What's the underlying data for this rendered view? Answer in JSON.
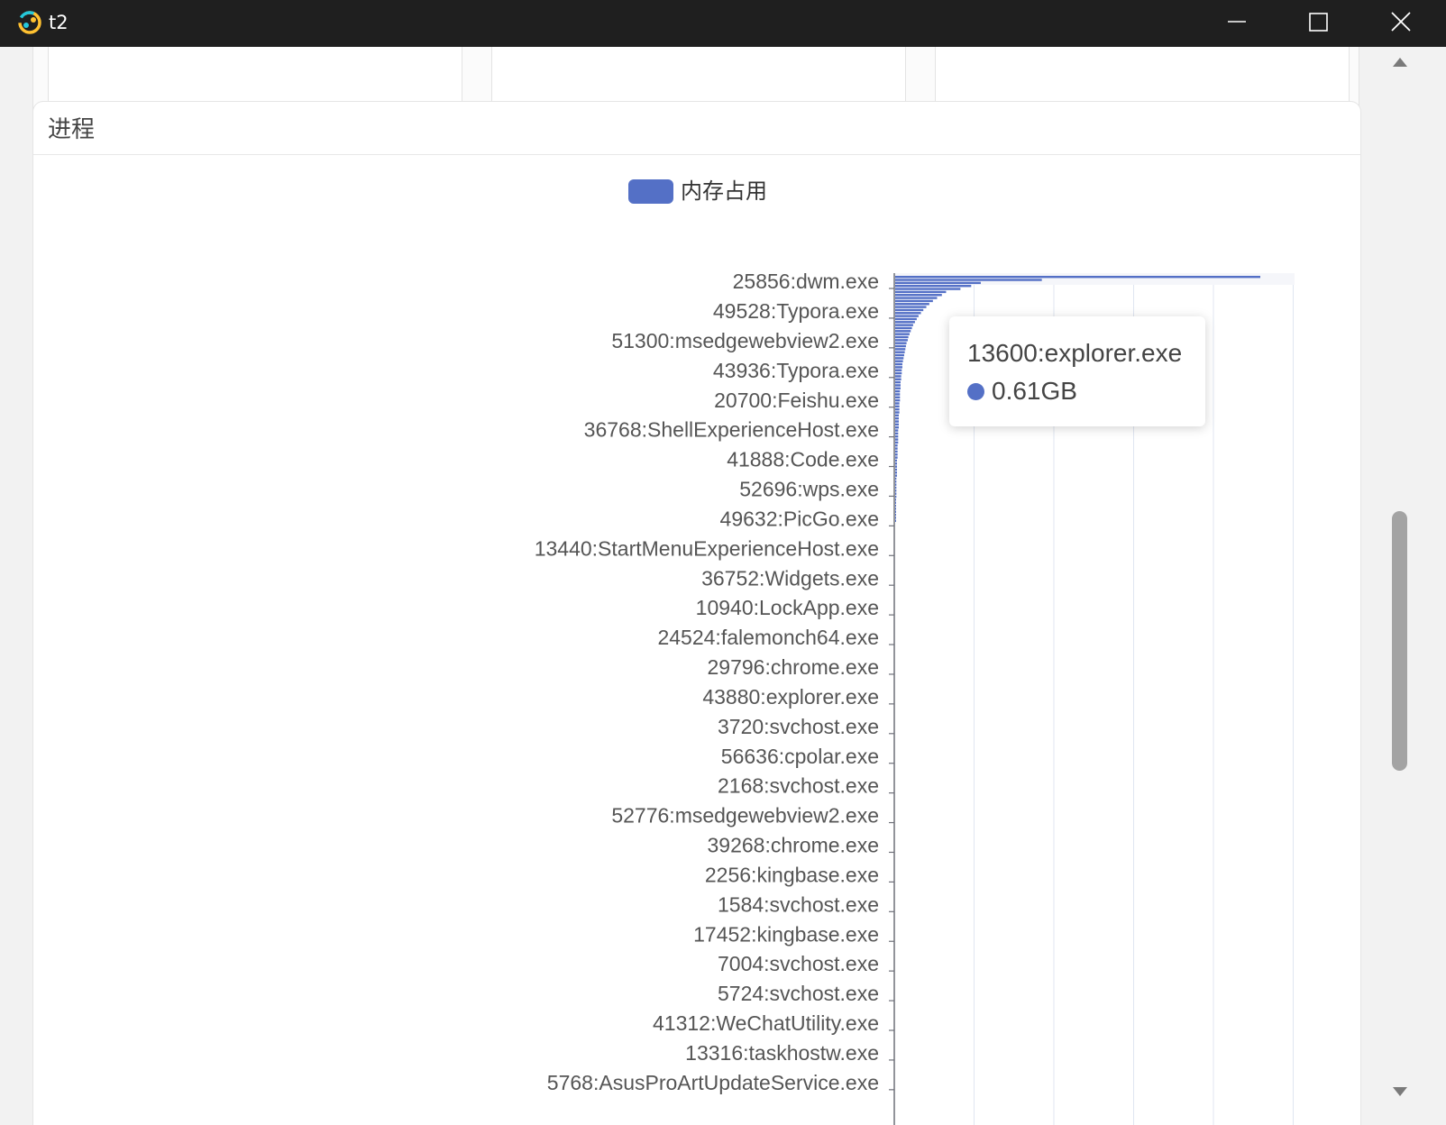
{
  "window": {
    "title": "t2",
    "controls": {
      "minimize": "minimize-icon",
      "maximize": "maximize-icon",
      "close": "close-icon"
    }
  },
  "panel": {
    "title": "进程"
  },
  "tooltip": {
    "name": "13600:explorer.exe",
    "value": "0.61GB"
  },
  "colors": {
    "series": "#5470c6",
    "titlebar": "#1f1f1f"
  },
  "chart_data": {
    "type": "bar",
    "orientation": "horizontal",
    "title": "",
    "legend": [
      "内存占用"
    ],
    "legend_position": "top-center",
    "series": [
      {
        "name": "内存占用",
        "values": [
          0.61,
          0.245,
          0.143,
          0.127,
          0.109,
          0.085,
          0.078,
          0.07,
          0.063,
          0.057,
          0.052,
          0.047,
          0.043,
          0.039,
          0.036,
          0.033,
          0.03,
          0.028,
          0.026,
          0.024,
          0.022,
          0.021,
          0.019,
          0.018,
          0.017,
          0.016,
          0.015,
          0.014,
          0.013,
          0.012,
          0.012,
          0.011,
          0.011,
          0.01,
          0.01,
          0.009,
          0.009,
          0.009,
          0.008,
          0.008,
          0.008,
          0.008,
          0.007,
          0.007,
          0.007,
          0.007,
          0.006,
          0.006,
          0.006,
          0.006,
          0.006,
          0.005,
          0.005,
          0.005,
          0.005,
          0.005,
          0.004,
          0.004,
          0.004,
          0.004,
          0.004,
          0.003,
          0.003,
          0.003,
          0.003,
          0.003,
          0.003,
          0.002,
          0.002,
          0.002,
          0.002,
          0.002,
          0.002,
          0.002,
          0.001,
          0.001,
          0.001,
          0.001,
          0.001,
          0.001,
          0.001,
          0.001
        ]
      }
    ],
    "tick_labels": [
      "25856:dwm.exe",
      "49528:Typora.exe",
      "51300:msedgewebview2.exe",
      "43936:Typora.exe",
      "20700:Feishu.exe",
      "36768:ShellExperienceHost.exe",
      "41888:Code.exe",
      "52696:wps.exe",
      "49632:PicGo.exe",
      "13440:StartMenuExperienceHost.exe",
      "36752:Widgets.exe",
      "10940:LockApp.exe",
      "24524:falemonch64.exe",
      "29796:chrome.exe",
      "43880:explorer.exe",
      "3720:svchost.exe",
      "56636:cpolar.exe",
      "2168:svchost.exe",
      "52776:msedgewebview2.exe",
      "39268:chrome.exe",
      "2256:kingbase.exe",
      "1584:svchost.exe",
      "17452:kingbase.exe",
      "7004:svchost.exe",
      "5724:svchost.exe",
      "41312:WeChatUtility.exe",
      "13316:taskhostw.exe",
      "5768:AsusProArtUpdateService.exe"
    ],
    "x_axis": {
      "min": 0,
      "max": 0.61,
      "grid": true,
      "tick_labels_visible": false
    },
    "y_axis": {
      "inverse": true
    },
    "highlighted": {
      "category": "13600:explorer.exe",
      "value": "0.61GB"
    }
  }
}
